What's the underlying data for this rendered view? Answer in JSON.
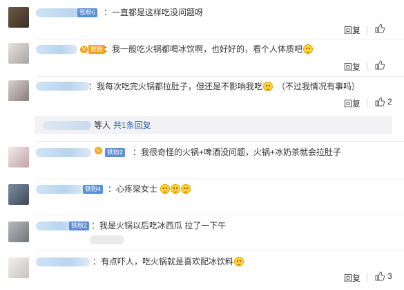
{
  "reply_label": "回复",
  "comments": [
    {
      "badge": "铁粉6",
      "text": "：一直都是这样吃没问题呀",
      "likes": "",
      "emojis": 0
    },
    {
      "badge": "铁粉",
      "text": "：我一般吃火锅都喝冰饮啊，也好好的，看个人体质吧",
      "likes": "",
      "emojis": 1
    },
    {
      "badge": "",
      "text": "：我每次吃完火锅都拉肚子，但还是不影响我吃",
      "text_after": "（不过我情况有事吗）",
      "likes": "2",
      "emojis": 1
    },
    {
      "badge": "铁粉2",
      "text": "：我很奇怪的火锅+啤酒没问题，火锅+冰奶茶就会拉肚子",
      "likes": "",
      "emojis": 0
    },
    {
      "badge": "铁粉4",
      "text": "：心疼梁女士",
      "likes": "",
      "emojis": 3
    },
    {
      "badge": "铁粉2",
      "text": "：我是火锅以后吃冰西瓜 拉了一下午",
      "likes": "",
      "emojis": 0
    },
    {
      "badge": "",
      "text": "：有点吓人，吃火锅就是喜欢配冰饮料",
      "likes": "3",
      "emojis": 1
    }
  ],
  "more_replies": {
    "suffix": "等人",
    "link": "共1条回复"
  },
  "icons": {
    "like": "thumbs-up-icon",
    "badge": "diamond-icon",
    "emoji": "smiley-emoji-icon"
  },
  "colors": {
    "link": "#2f64b1",
    "badge_blue": "#5a8fd8",
    "badge_gold": "#f2a41c",
    "more_bg": "#f2f2f5"
  }
}
